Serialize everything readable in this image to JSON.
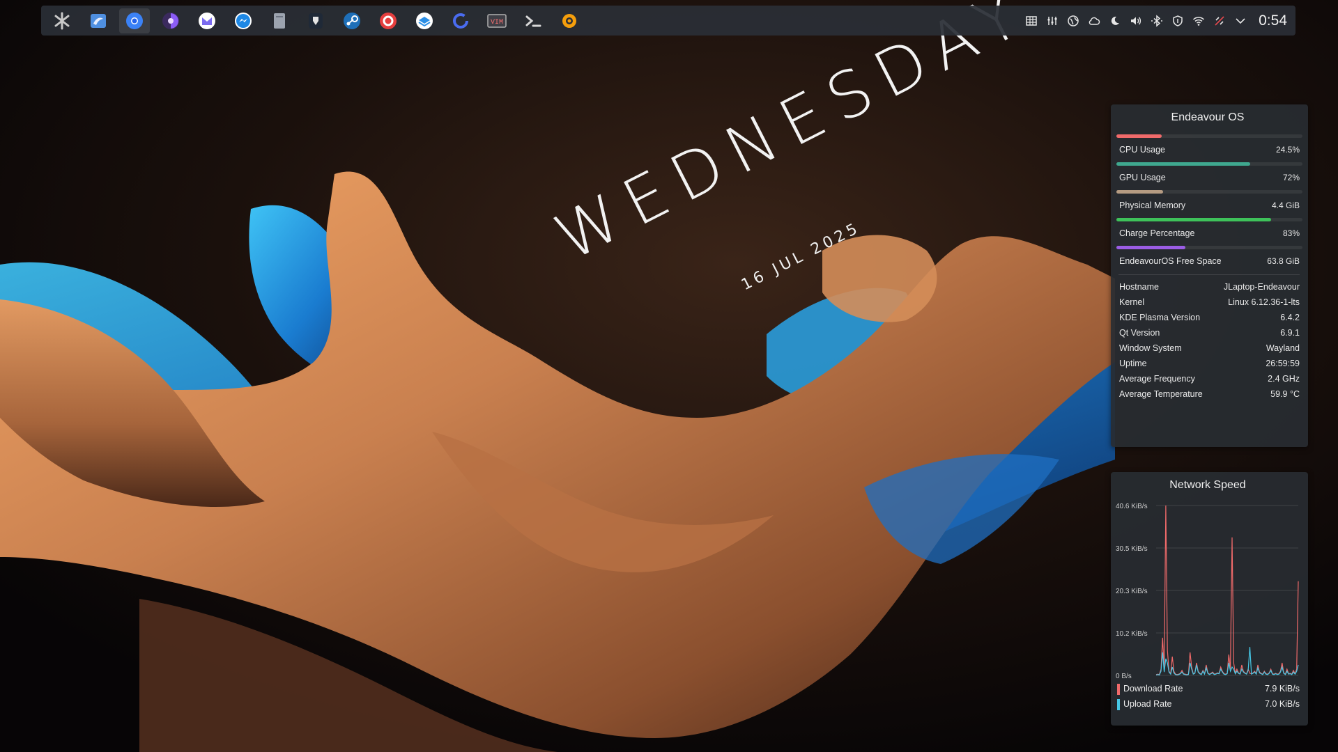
{
  "wallpaper": {
    "day": "WEDNESDAY",
    "date": "16 JUL 2025"
  },
  "panel": {
    "launchers": [
      {
        "name": "kde-application-launcher-icon",
        "color": "#c9c9c9"
      },
      {
        "name": "dolphin-file-manager-icon",
        "color": "#4f8fe0"
      },
      {
        "name": "chromium-browser-icon",
        "color": "#3b82f6"
      },
      {
        "name": "tor-browser-icon",
        "color": "#8b5cf6"
      },
      {
        "name": "proton-mail-icon",
        "color": "#7c6cf0"
      },
      {
        "name": "messenger-icon",
        "color": "#1e88e5"
      },
      {
        "name": "notes-app-icon",
        "color": "#9ca3af"
      },
      {
        "name": "bitwarden-icon",
        "color": "#e5e5e5"
      },
      {
        "name": "steam-icon",
        "color": "#1e6fb8"
      },
      {
        "name": "red-circle-app-icon",
        "color": "#e53e3e"
      },
      {
        "name": "blue-stack-app-icon",
        "color": "#2b8fe6"
      },
      {
        "name": "blue-ring-app-icon",
        "color": "#4a6cf0"
      },
      {
        "name": "vim-editor-icon",
        "color": "#b0b0b0"
      },
      {
        "name": "terminal-icon",
        "color": "#d8d8d8"
      },
      {
        "name": "settings-gear-icon",
        "color": "#f59e0b"
      }
    ],
    "tray": [
      "grid-widget-icon",
      "audio-mixer-icon",
      "vpn-globe-icon",
      "cloud-sync-icon",
      "night-light-moon-icon",
      "volume-icon",
      "bluetooth-icon",
      "security-shield-icon",
      "wifi-icon",
      "network-disconnected-icon",
      "expand-tray-chevron-icon"
    ],
    "clock": "0:54"
  },
  "sysinfo": {
    "title": "Endeavour OS",
    "meters": [
      {
        "label": "CPU Usage",
        "value": "24.5%",
        "fraction": 0.245,
        "color": "#f06a6a"
      },
      {
        "label": "GPU Usage",
        "value": "72%",
        "fraction": 0.72,
        "color": "#3fa88f"
      },
      {
        "label": "Physical Memory",
        "value": "4.4 GiB",
        "fraction": 0.25,
        "color": "#b59b82"
      },
      {
        "label": "Charge Percentage",
        "value": "83%",
        "fraction": 0.83,
        "color": "#3ec25a"
      },
      {
        "label": "EndeavourOS Free Space",
        "value": "63.8 GiB",
        "fraction": 0.37,
        "color": "#9b5de5"
      }
    ],
    "info": [
      {
        "label": "Hostname",
        "value": "JLaptop-Endeavour"
      },
      {
        "label": "Kernel",
        "value": "Linux 6.12.36-1-lts"
      },
      {
        "label": "KDE Plasma Version",
        "value": "6.4.2"
      },
      {
        "label": "Qt Version",
        "value": "6.9.1"
      },
      {
        "label": "Window System",
        "value": "Wayland"
      },
      {
        "label": "Uptime",
        "value": "26:59:59"
      },
      {
        "label": "Average Frequency",
        "value": "2.4 GHz"
      },
      {
        "label": "Average Temperature",
        "value": "59.9 °C"
      }
    ]
  },
  "network": {
    "title": "Network Speed",
    "legend": [
      {
        "label": "Download Rate",
        "value": "7.9 KiB/s",
        "color": "#f06a6a"
      },
      {
        "label": "Upload Rate",
        "value": "7.0 KiB/s",
        "color": "#46c8e6"
      }
    ]
  },
  "chart_data": {
    "type": "line",
    "title": "Network Speed",
    "y_unit": "KiB/s",
    "yticks": [
      "40.6 KiB/s",
      "30.5 KiB/s",
      "20.3 KiB/s",
      "10.2 KiB/s",
      "0 B/s"
    ],
    "ylim": [
      0,
      40.6
    ],
    "grid": true,
    "legend_position": "bottom",
    "series": [
      {
        "name": "Download Rate",
        "color": "#f06a6a",
        "values": [
          0.2,
          0.3,
          0.2,
          1.5,
          9.0,
          1.0,
          40.6,
          6.0,
          1.0,
          0.4,
          4.5,
          1.0,
          0.3,
          0.2,
          0.3,
          0.5,
          1.2,
          0.4,
          0.3,
          0.2,
          0.3,
          5.5,
          2.0,
          0.4,
          0.6,
          3.0,
          1.0,
          0.5,
          0.3,
          1.2,
          0.4,
          2.5,
          0.6,
          0.3,
          0.5,
          0.8,
          0.3,
          0.4,
          0.6,
          0.5,
          2.0,
          1.0,
          0.4,
          0.3,
          0.5,
          5.0,
          1.5,
          33.0,
          3.0,
          0.5,
          1.5,
          0.6,
          0.4,
          2.5,
          1.0,
          0.6,
          0.4,
          1.5,
          0.5,
          0.4,
          0.6,
          1.0,
          0.4,
          2.5,
          0.8,
          0.5,
          0.3,
          1.0,
          0.4,
          0.3,
          0.6,
          1.5,
          0.4,
          0.3,
          0.5,
          0.3,
          0.4,
          1.0,
          3.0,
          0.6,
          0.3,
          1.5,
          0.4,
          0.5,
          0.3,
          1.2,
          0.4,
          1.5,
          22.5
        ]
      },
      {
        "name": "Upload Rate",
        "color": "#46c8e6",
        "values": [
          0.1,
          0.2,
          0.1,
          1.0,
          5.5,
          0.8,
          4.0,
          3.0,
          0.8,
          0.3,
          2.0,
          0.6,
          0.2,
          0.1,
          0.2,
          0.4,
          0.8,
          0.3,
          0.2,
          0.1,
          0.2,
          3.0,
          1.5,
          0.3,
          0.5,
          2.5,
          0.8,
          0.4,
          0.2,
          1.0,
          0.3,
          1.8,
          0.5,
          0.2,
          0.4,
          0.6,
          0.2,
          0.3,
          0.5,
          0.4,
          1.5,
          0.8,
          0.3,
          0.2,
          0.4,
          3.0,
          1.0,
          2.0,
          1.5,
          0.4,
          1.0,
          0.5,
          0.3,
          1.5,
          0.8,
          0.5,
          0.3,
          1.2,
          6.8,
          0.3,
          0.5,
          0.8,
          0.3,
          1.8,
          0.6,
          0.4,
          0.2,
          0.8,
          0.3,
          0.2,
          0.5,
          1.2,
          0.3,
          0.2,
          0.4,
          0.2,
          0.3,
          0.8,
          2.0,
          0.5,
          0.2,
          1.0,
          0.3,
          0.4,
          0.2,
          0.8,
          0.3,
          1.0,
          2.5
        ]
      }
    ]
  }
}
